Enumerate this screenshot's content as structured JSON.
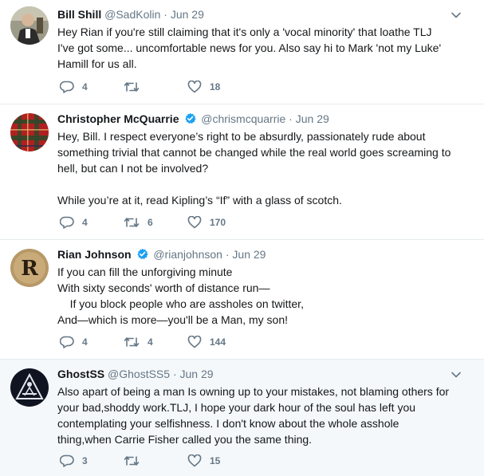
{
  "tweets": [
    {
      "name": "Bill Shill",
      "handle": "@SadKolin",
      "dot": "·",
      "time": "Jun 29",
      "verified": false,
      "text": "Hey Rian if you're still claiming that it's only a 'vocal minority' that loathe TLJ\nI've got some... uncomfortable news for you. Also say hi to Mark 'not my Luke'\nHamill for us all.",
      "replies": "4",
      "retweets": "",
      "likes": "18"
    },
    {
      "name": "Christopher McQuarrie",
      "handle": "@chrismcquarrie",
      "dot": "·",
      "time": "Jun 29",
      "verified": true,
      "text": "Hey, Bill. I respect everyone’s right to be absurdly, passionately rude about\nsomething trivial that cannot be changed while the real world goes screaming to\nhell, but can I not be involved?\n\nWhile you’re at it, read Kipling’s “If” with a glass of scotch.",
      "replies": "4",
      "retweets": "6",
      "likes": "170"
    },
    {
      "name": "Rian Johnson",
      "handle": "@rianjohnson",
      "dot": "·",
      "time": "Jun 29",
      "verified": true,
      "avatar_letter": "R",
      "text": "If you can fill the unforgiving minute\nWith sixty seconds' worth of distance run—\n    If you block people who are assholes on twitter,\nAnd—which is more—you'll be a Man, my son!",
      "replies": "4",
      "retweets": "4",
      "likes": "144"
    },
    {
      "name": "GhostSS",
      "handle": "@GhostSS5",
      "dot": "·",
      "time": "Jun 29",
      "verified": false,
      "text": "Also apart of being a man Is owning up to your mistakes, not blaming others for\nyour bad,shoddy work.TLJ, I hope your dark hour of the soul has left you\ncontemplating your selfishness. I don't know about the whole asshole\nthing,when Carrie Fisher called you the same thing.",
      "replies": "3",
      "retweets": "",
      "likes": "15"
    }
  ],
  "colors": {
    "text": "#14171a",
    "secondary": "#657786",
    "verified": "#1da1f2",
    "highlight_bg": "#f5f8fa",
    "divider": "#e6ecf0"
  },
  "icons": [
    "reply-icon",
    "retweet-icon",
    "like-icon",
    "verified-icon",
    "chevron-down-icon"
  ]
}
